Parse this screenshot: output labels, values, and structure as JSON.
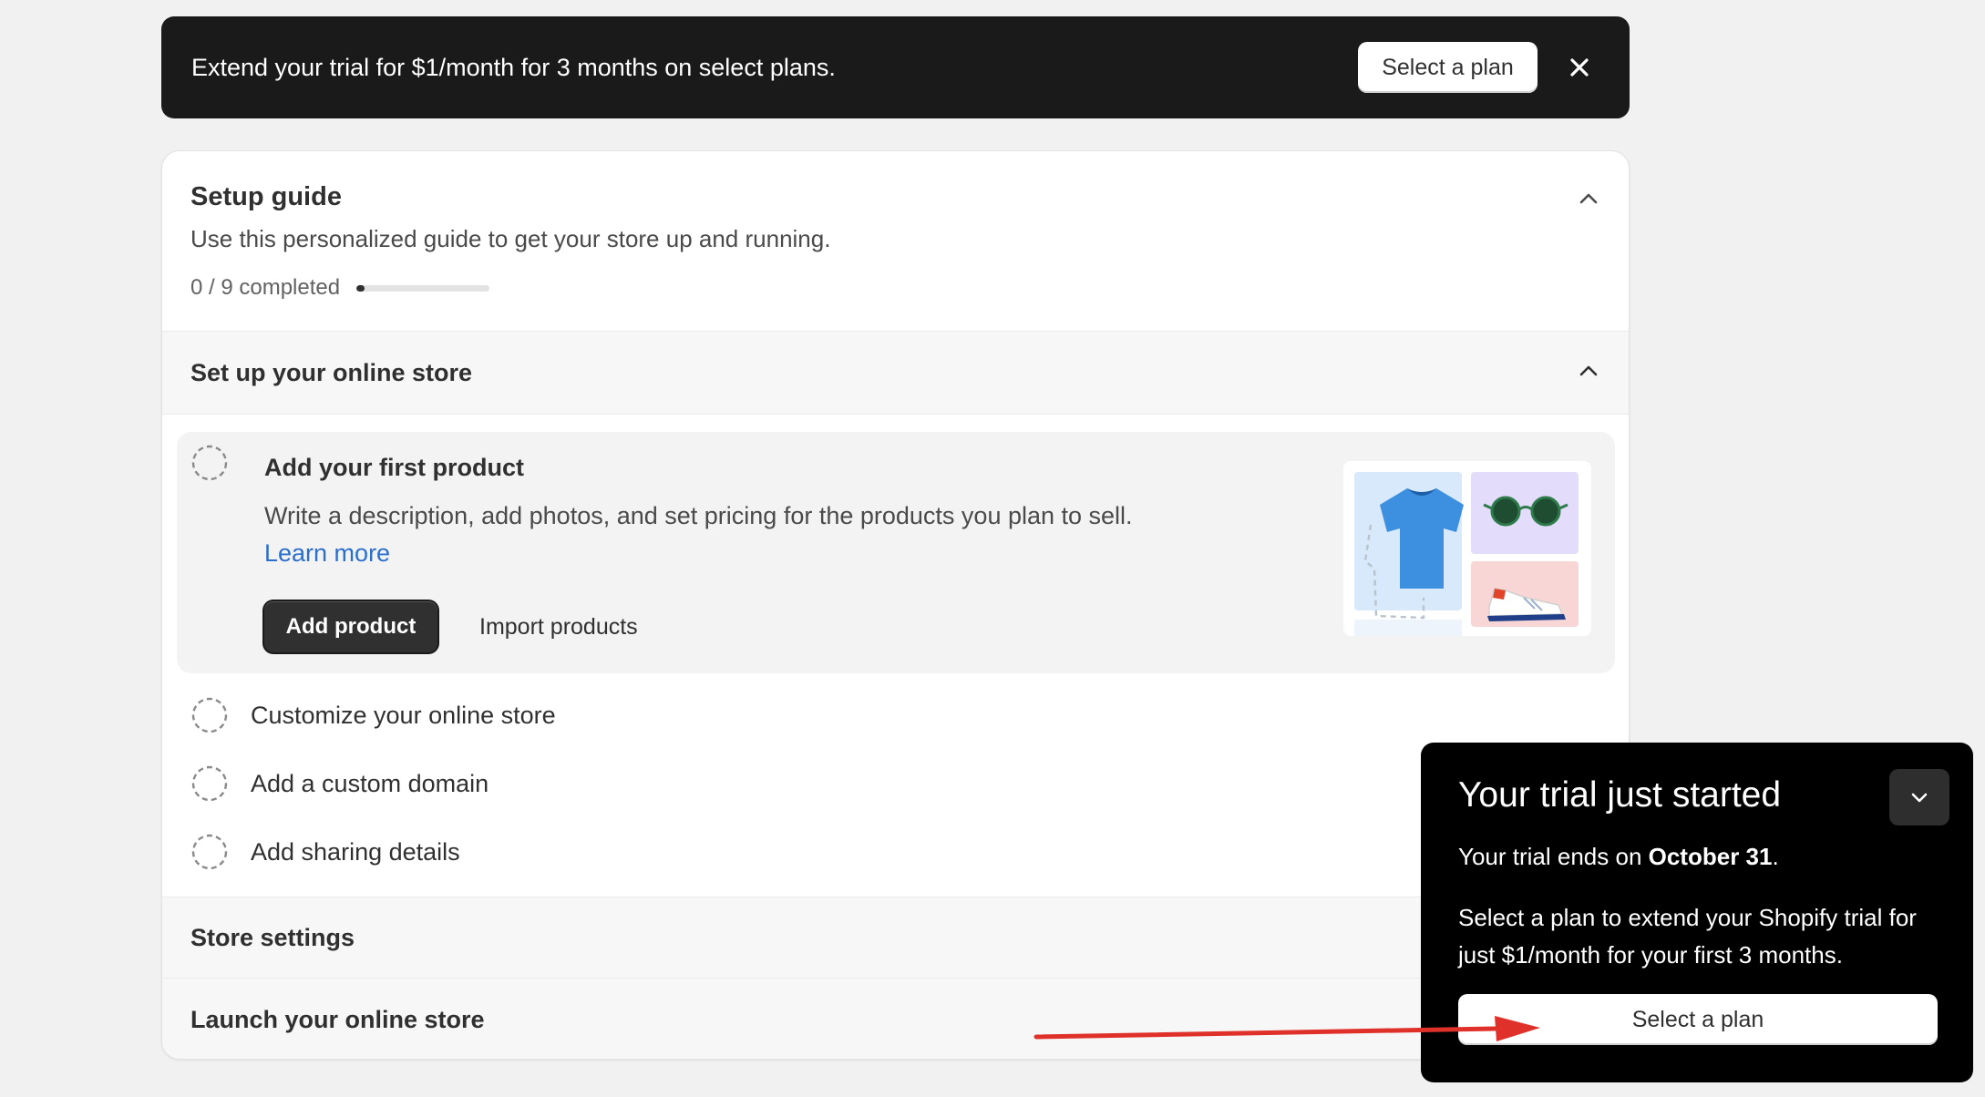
{
  "banner": {
    "text": "Extend your trial for $1/month for 3 months on select plans.",
    "button_label": "Select a plan",
    "close_icon": "close-icon"
  },
  "setup_guide": {
    "title": "Setup guide",
    "subtitle": "Use this personalized guide to get your store up and running.",
    "progress_text": "0 / 9 completed",
    "progress_fraction": 0.03,
    "collapse_icon": "chevron-up-icon"
  },
  "sections": [
    {
      "title": "Set up your online store"
    },
    {
      "title": "Store settings"
    },
    {
      "title": "Launch your online store"
    }
  ],
  "active_task": {
    "title": "Add your first product",
    "description": "Write a description, add photos, and set pricing for the products you plan to sell.",
    "learn_more": "Learn more",
    "primary_label": "Add product",
    "secondary_label": "Import products"
  },
  "tasks": [
    {
      "label": "Customize your online store"
    },
    {
      "label": "Add a custom domain"
    },
    {
      "label": "Add sharing details"
    }
  ],
  "popup": {
    "title": "Your trial just started",
    "ends_prefix": "Your trial ends on ",
    "ends_date": "October 31",
    "ends_suffix": ".",
    "description": "Select a plan to extend your Shopify trial for just $1/month for your first 3 months.",
    "button_label": "Select a plan",
    "collapse_icon": "chevron-down-icon"
  },
  "colors": {
    "banner_bg": "#1a1a1a",
    "popup_bg": "#000000",
    "link": "#2c6ecb",
    "arrow": "#e0302a"
  }
}
